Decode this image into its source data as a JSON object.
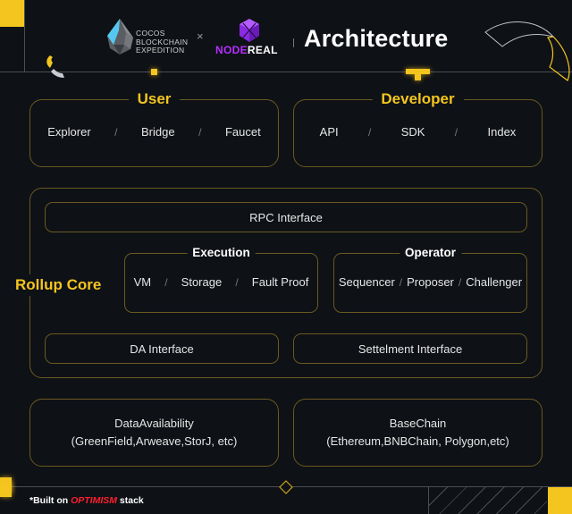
{
  "header": {
    "title": "Architecture",
    "partner_logo": {
      "name": "cocos-logo",
      "lines": [
        "COCOS",
        "BLOCKCHAIN",
        "EXPEDITION"
      ]
    },
    "cross_symbol": "×",
    "nodereal_logo": {
      "part1": "NODE",
      "part2": "REAL"
    }
  },
  "user": {
    "title": "User",
    "items": [
      "Explorer",
      "Bridge",
      "Faucet"
    ],
    "separator": "/"
  },
  "developer": {
    "title": "Developer",
    "items": [
      "API",
      "SDK",
      "Index"
    ],
    "separator": "/"
  },
  "rollup_core": {
    "label": "Rollup Core",
    "rpc_interface": "RPC Interface",
    "execution": {
      "title": "Execution",
      "items": [
        "VM",
        "Storage",
        "Fault Proof"
      ],
      "separator": "/"
    },
    "operator": {
      "title": "Operator",
      "items": [
        "Sequencer",
        "Proposer",
        "Challenger"
      ],
      "separator": "/"
    },
    "da_interface": "DA Interface",
    "settlement_interface": "Settelment Interface"
  },
  "data_availability": {
    "title": "DataAvailability",
    "detail": "(GreenField,Arweave,StorJ, etc)"
  },
  "base_chain": {
    "title": "BaseChain",
    "detail": "(Ethereum,BNBChain, Polygon,etc)"
  },
  "footer": {
    "prefix": "*Built on ",
    "highlight": "OPTIMISM",
    "suffix": " stack"
  },
  "colors": {
    "background": "#0e1116",
    "accent_yellow": "#f4c51f",
    "border_gold": "#6a5a1f",
    "optimism_red": "#ff1e2e",
    "nodereal_purple": "#b730ff",
    "cocos_blue": "#55c8f0"
  }
}
